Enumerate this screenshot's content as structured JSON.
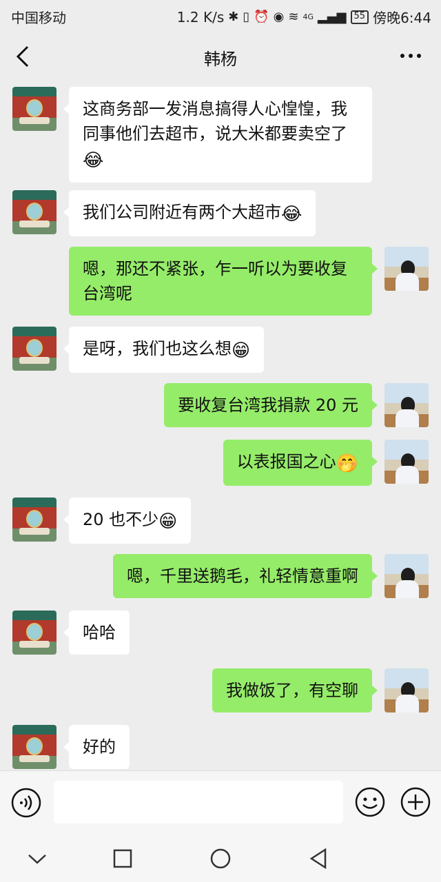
{
  "status_bar": {
    "carrier": "中国移动",
    "speed": "1.2 K/s",
    "network": "4G",
    "battery": "55",
    "time": "傍晚6:44"
  },
  "header": {
    "title": "韩杨",
    "back_icon": "chevron-left-icon",
    "more_icon": "more-dots-icon"
  },
  "messages": [
    {
      "side": "left",
      "text": "这商务部一发消息搞得人心惶惶，我同事他们去超市，说大米都要卖空了",
      "emoji": "😂"
    },
    {
      "side": "left",
      "text": "我们公司附近有两个大超市",
      "emoji": "😂"
    },
    {
      "side": "right",
      "text": "嗯，那还不紧张，乍一听以为要收复台湾呢",
      "emoji": ""
    },
    {
      "side": "left",
      "text": "是呀，我们也这么想",
      "emoji": "😁"
    },
    {
      "side": "right",
      "text": "要收复台湾我捐款 20 元",
      "emoji": ""
    },
    {
      "side": "right",
      "text": "以表报国之心",
      "emoji": "🤭"
    },
    {
      "side": "left",
      "text": "20 也不少",
      "emoji": "😁"
    },
    {
      "side": "right",
      "text": "嗯，千里送鹅毛，礼轻情意重啊",
      "emoji": ""
    },
    {
      "side": "left",
      "text": "哈哈",
      "emoji": ""
    },
    {
      "side": "right",
      "text": "我做饭了，有空聊",
      "emoji": ""
    },
    {
      "side": "left",
      "text": "好的",
      "emoji": ""
    }
  ],
  "input_bar": {
    "value": "",
    "voice_icon": "voice-icon",
    "emoji_icon": "emoji-face-icon",
    "plus_icon": "plus-icon"
  },
  "colors": {
    "background": "#ededed",
    "sent_bubble": "#95ec69",
    "received_bubble": "#ffffff"
  }
}
